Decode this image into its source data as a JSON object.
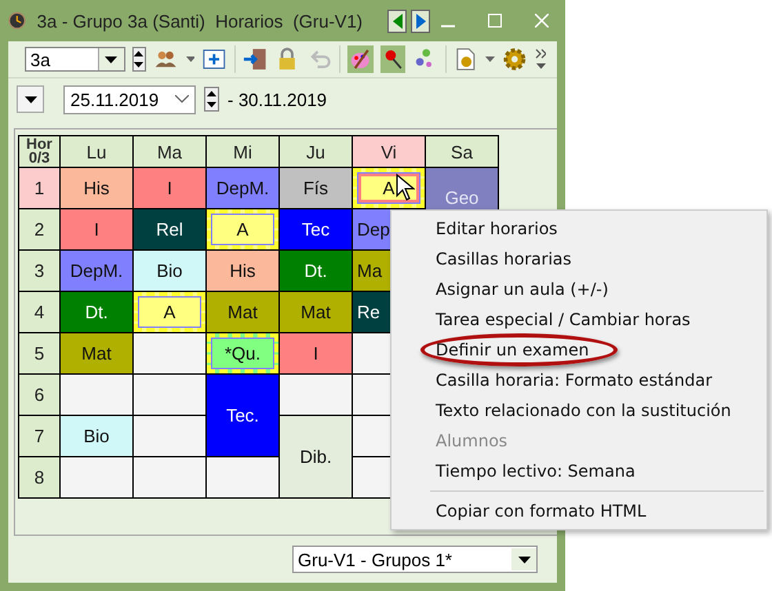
{
  "window": {
    "title": "3a - Grupo 3a (Santi)  Horarios  (Gru-V1)"
  },
  "toolbar": {
    "class_combo": {
      "value": "3a"
    }
  },
  "date_bar": {
    "from": "25.11.2019",
    "to": "- 30.11.2019"
  },
  "timetable": {
    "corner": [
      "Hor",
      "0/3"
    ],
    "days": [
      {
        "label": "Lu",
        "selected": false
      },
      {
        "label": "Ma",
        "selected": false
      },
      {
        "label": "Mi",
        "selected": false
      },
      {
        "label": "Ju",
        "selected": false
      },
      {
        "label": "Vi",
        "selected": true
      },
      {
        "label": "Sa",
        "selected": false
      }
    ],
    "rows": [
      {
        "hour": "1",
        "selected": true,
        "cells": [
          {
            "text": "His",
            "color": "#fbb89a"
          },
          {
            "text": "I",
            "color": "#ff8080"
          },
          {
            "text": "DepM.",
            "color": "#8080ff"
          },
          {
            "text": "Fís",
            "color": "#c0c0c0"
          },
          {
            "text": "A",
            "color": "#ffff80",
            "kind": "exam",
            "selected": true
          },
          {
            "text": "Geo",
            "color": "#8080c0",
            "rowspan": 2,
            "kind": "top"
          }
        ]
      },
      {
        "hour": "2",
        "selected": false,
        "cells": [
          {
            "text": "I",
            "color": "#ff8080"
          },
          {
            "text": "Rel",
            "color": "#004040"
          },
          {
            "text": "A",
            "color": "#ffff80",
            "kind": "exam"
          },
          {
            "text": "Tec",
            "color": "#0000ff"
          },
          {
            "text": "Dep",
            "color": "#8080ff",
            "kind": "partial"
          }
        ]
      },
      {
        "hour": "3",
        "selected": false,
        "cells": [
          {
            "text": "DepM.",
            "color": "#8080ff"
          },
          {
            "text": "Bio",
            "color": "#d0f8f8"
          },
          {
            "text": "His",
            "color": "#fbb89a"
          },
          {
            "text": "Dt.",
            "color": "#008000"
          },
          {
            "text": "Ma",
            "color": "#b0b000",
            "kind": "partial"
          }
        ]
      },
      {
        "hour": "4",
        "selected": false,
        "cells": [
          {
            "text": "Dt.",
            "color": "#008000"
          },
          {
            "text": "A",
            "color": "#ffff80",
            "kind": "exam"
          },
          {
            "text": "Mat",
            "color": "#b0b000"
          },
          {
            "text": "Mat",
            "color": "#b0b000"
          },
          {
            "text": "Re",
            "color": "#004040",
            "kind": "partial"
          }
        ]
      },
      {
        "hour": "5",
        "selected": false,
        "cells": [
          {
            "text": "Mat",
            "color": "#b0b000"
          },
          {
            "color": "#f4f4f4"
          },
          {
            "text": "*Qu.",
            "color": "#80ff80",
            "kind": "exam"
          },
          {
            "text": "I",
            "color": "#ff8080"
          },
          {
            "color": "#f4f4f4"
          }
        ]
      },
      {
        "hour": "6",
        "selected": false,
        "cells": [
          {
            "color": "#f4f4f4"
          },
          {
            "color": "#f4f4f4"
          },
          {
            "text": "Tec.",
            "color": "#0000ff",
            "rowspan": 2
          },
          {
            "color": "#f4f4f4"
          },
          {
            "color": "#f4f4f4"
          }
        ]
      },
      {
        "hour": "7",
        "selected": false,
        "cells": [
          {
            "text": "Bio",
            "color": "#d0f8f8"
          },
          {
            "color": "#f4f4f4"
          },
          {
            "text": "Dib.",
            "color": "#e4ecdc",
            "rowspan": 2
          },
          {
            "color": "#f4f4f4"
          }
        ]
      },
      {
        "hour": "8",
        "selected": false,
        "cells": [
          {
            "color": "#f4f4f4"
          },
          {
            "color": "#f4f4f4"
          },
          {
            "color": "#f4f4f4"
          },
          {
            "color": "#f4f4f4"
          }
        ]
      }
    ]
  },
  "context_menu": {
    "items": [
      {
        "label": "Editar horarios",
        "disabled": false,
        "circled": false
      },
      {
        "label": "Casillas horarias",
        "disabled": false,
        "circled": false
      },
      {
        "label": "Asignar un aula (+/-)",
        "disabled": false,
        "circled": false
      },
      {
        "label": "Tarea especial / Cambiar horas",
        "disabled": false,
        "circled": false
      },
      {
        "label": "Definir un examen",
        "disabled": false,
        "circled": true
      },
      {
        "label": "Casilla horaria: Formato estándar",
        "disabled": false,
        "circled": false
      },
      {
        "label": "Texto relacionado con la sustitución",
        "disabled": false,
        "circled": false
      },
      {
        "label": "Alumnos",
        "disabled": true,
        "circled": false
      },
      {
        "label": "Tiempo lectivo: Semana",
        "disabled": false,
        "circled": false,
        "separator_after": true
      },
      {
        "label": "Copiar con formato HTML",
        "disabled": false,
        "circled": false
      }
    ]
  },
  "status_combo": {
    "value": "Gru-V1 - Grupos 1*"
  }
}
